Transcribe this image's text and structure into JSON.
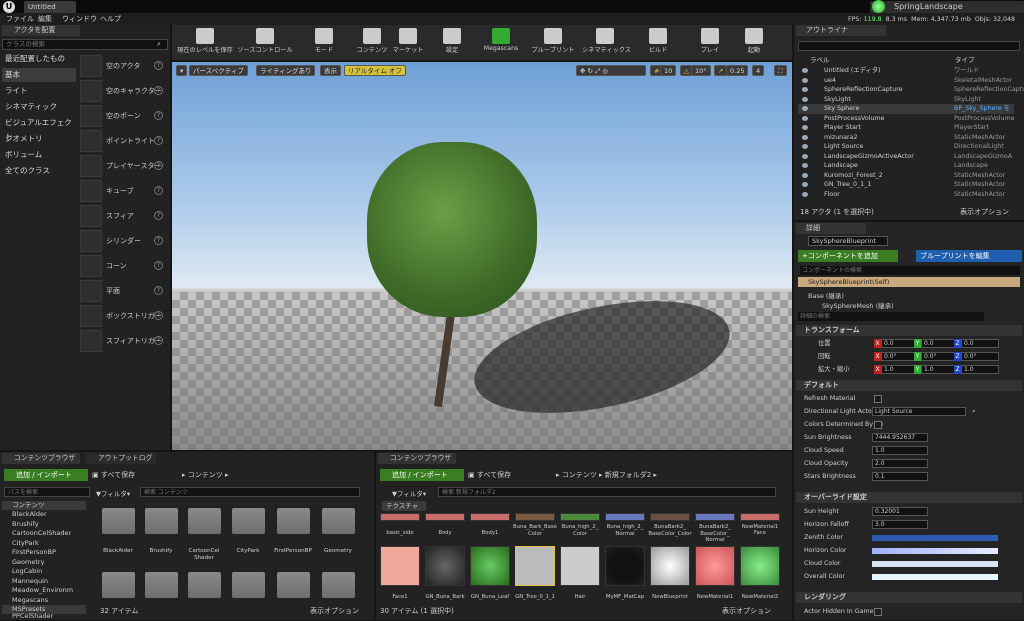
{
  "title": {
    "tab": "Untitled",
    "project": "SpringLandscape"
  },
  "stats": {
    "fps_label": "FPS:",
    "fps": "119.8",
    "ms": "8.3 ms",
    "mem_label": "Mem:",
    "mem": "4,347.73 mb",
    "objs_label": "Objs:",
    "objs": "32,048"
  },
  "menu": [
    "ファイル",
    "編集",
    "ウィンドウ",
    "ヘルプ"
  ],
  "place": {
    "tab": "アクタを配置",
    "search_placeholder": "クラスの検索",
    "categories": [
      "最近配置したもの",
      "基本",
      "ライト",
      "シネマティック",
      "ビジュアルエフェクト",
      "ジオメトリ",
      "ボリューム",
      "全てのクラス"
    ],
    "items": [
      "空のアクタ",
      "空のキャラクター",
      "空のポーン",
      "ポイントライト",
      "プレイヤースター",
      "キューブ",
      "スフィア",
      "シリンダー",
      "コーン",
      "平面",
      "ボックストリガー",
      "スフィアトリガー"
    ]
  },
  "toolbar": [
    "現在のレベルを保存",
    "ソースコントロール",
    "モード",
    "コンテンツ",
    "マーケット",
    "設定",
    "Megascans",
    "ブループリント",
    "シネマティックス",
    "ビルド",
    "プレイ",
    "起動"
  ],
  "viewport": {
    "perspective": "パースペクティブ",
    "lighting": "ライティングあり",
    "show": "表示",
    "realtime": "リアルタイム オフ",
    "grid": "10",
    "angle": "10°",
    "scale": "0.25",
    "cam": "4"
  },
  "outliner": {
    "tab": "アウトライナ",
    "col_label": "ラベル",
    "col_type": "タイプ",
    "rows": [
      [
        "Untitled (エディタ)",
        "ワールド"
      ],
      [
        "ue4",
        "SkeletalMeshActor"
      ],
      [
        "SphereReflectionCapture",
        "SphereReflectionCapture"
      ],
      [
        "SkyLight",
        "SkyLight"
      ],
      [
        "Sky Sphere",
        "BP_Sky_Sphere を"
      ],
      [
        "PostProcessVolume",
        "PostProcessVolume"
      ],
      [
        "Player Start",
        "PlayerStart"
      ],
      [
        "mizunara2",
        "StaticMeshActor"
      ],
      [
        "Light Source",
        "DirectionalLight"
      ],
      [
        "LandscapeGizmoActiveActor",
        "LandscapeGizmoA"
      ],
      [
        "Landscape",
        "Landscape"
      ],
      [
        "Kuromozi_Forest_2",
        "StaticMeshActor"
      ],
      [
        "GN_Tree_0_1_1",
        "StaticMeshActor"
      ],
      [
        "Floor",
        "StaticMeshActor"
      ]
    ],
    "footer": "18 アクタ (1 を選択中)",
    "view_options": "表示オプション"
  },
  "details": {
    "tab": "詳細",
    "actor_name": "SkySphereBlueprint",
    "add_component": "+コンポーネントを追加",
    "edit_bp": "ブループリントを編集",
    "comp_search": "コンポーネントの検索",
    "self": "SkySphereBlueprint(Self)",
    "base": "Base (継承)",
    "mesh": "SkySphereMesh (継承)",
    "detail_search": "詳細の検索",
    "transform": "トランスフォーム",
    "loc": "位置",
    "rot": "回転",
    "scl": "拡大・縮小",
    "loc_v": [
      "0.0",
      "0.0",
      "0.0"
    ],
    "rot_v": [
      "0.0°",
      "0.0°",
      "0.0°"
    ],
    "scl_v": [
      "1.0",
      "1.0",
      "1.0"
    ],
    "default": "デフォルト",
    "refresh": "Refresh Material",
    "dir_light": "Directional Light Actor",
    "dir_light_v": "Light Source",
    "colors_det": "Colors Determined By Su",
    "sun_b": "Sun Brightness",
    "sun_b_v": "7444.952637",
    "cloud_s": "Cloud Speed",
    "cloud_s_v": "1.0",
    "cloud_o": "Cloud Opacity",
    "cloud_o_v": "2.0",
    "stars_b": "Stars Brightness",
    "stars_b_v": "0.1",
    "override": "オーバーライド設定",
    "sun_h": "Sun Height",
    "sun_h_v": "0.32001",
    "hor_f": "Horizon Falloff",
    "hor_f_v": "3.0",
    "zenith": "Zenith Color",
    "horizon": "Horizon Color",
    "cloud_c": "Cloud Color",
    "overall": "Overall Color",
    "render": "レンダリング",
    "hidden": "Actor Hidden In Game"
  },
  "cb1": {
    "tab": "コンテンツブラウザ",
    "tab2": "アウトプットログ",
    "add": "追加 / インポート",
    "save": "すべて保存",
    "path": "コンテンツ",
    "filter": "フィルタ",
    "search": "検索 コンテンツ",
    "path_search": "パスを検索",
    "tree": [
      "コンテンツ",
      "BlackAlder",
      "Brushify",
      "CartoonCelShader",
      "CityPark",
      "FirstPersonBP",
      "Geometry",
      "LogCabin",
      "Mannequin",
      "Meadow_Environm",
      "Megascans",
      "MSPresets",
      "PPCelShader"
    ],
    "folders": [
      "BlackAlder",
      "Brushify",
      "CartoonCel Shader",
      "CityPark",
      "FirstPersonBP",
      "Geometry"
    ],
    "count": "32 アイテム",
    "view_options": "表示オプション"
  },
  "cb2": {
    "tab": "コンテンツブラウザ",
    "add": "追加 / インポート",
    "save": "すべて保存",
    "path1": "コンテンツ",
    "path2": "新規フォルダ2",
    "filter": "フィルタ",
    "search": "検索 新規フォルダ2",
    "texture": "テクスチャ",
    "row1": [
      "basic_side",
      "Body",
      "Body1",
      "Buna_Bark_Base Color",
      "Buna_high_2_ Color",
      "Buna_high_2_ Normal",
      "BunaBark2_ BaseColor_Color",
      "BunaBark2_ BaseColor_ Normal",
      "NewMaterial1",
      "Face"
    ],
    "row2": [
      "Face1",
      "GN_Buna_Bark",
      "GN_Buna_Leaf",
      "GN_Tree_0_1_1",
      "Hair",
      "MyMF_MatCap",
      "NewBlueprint",
      "NewMaterial1",
      "NewMaterial2"
    ],
    "count": "30 アイテム (1 選択中)",
    "view_options": "表示オプション"
  }
}
